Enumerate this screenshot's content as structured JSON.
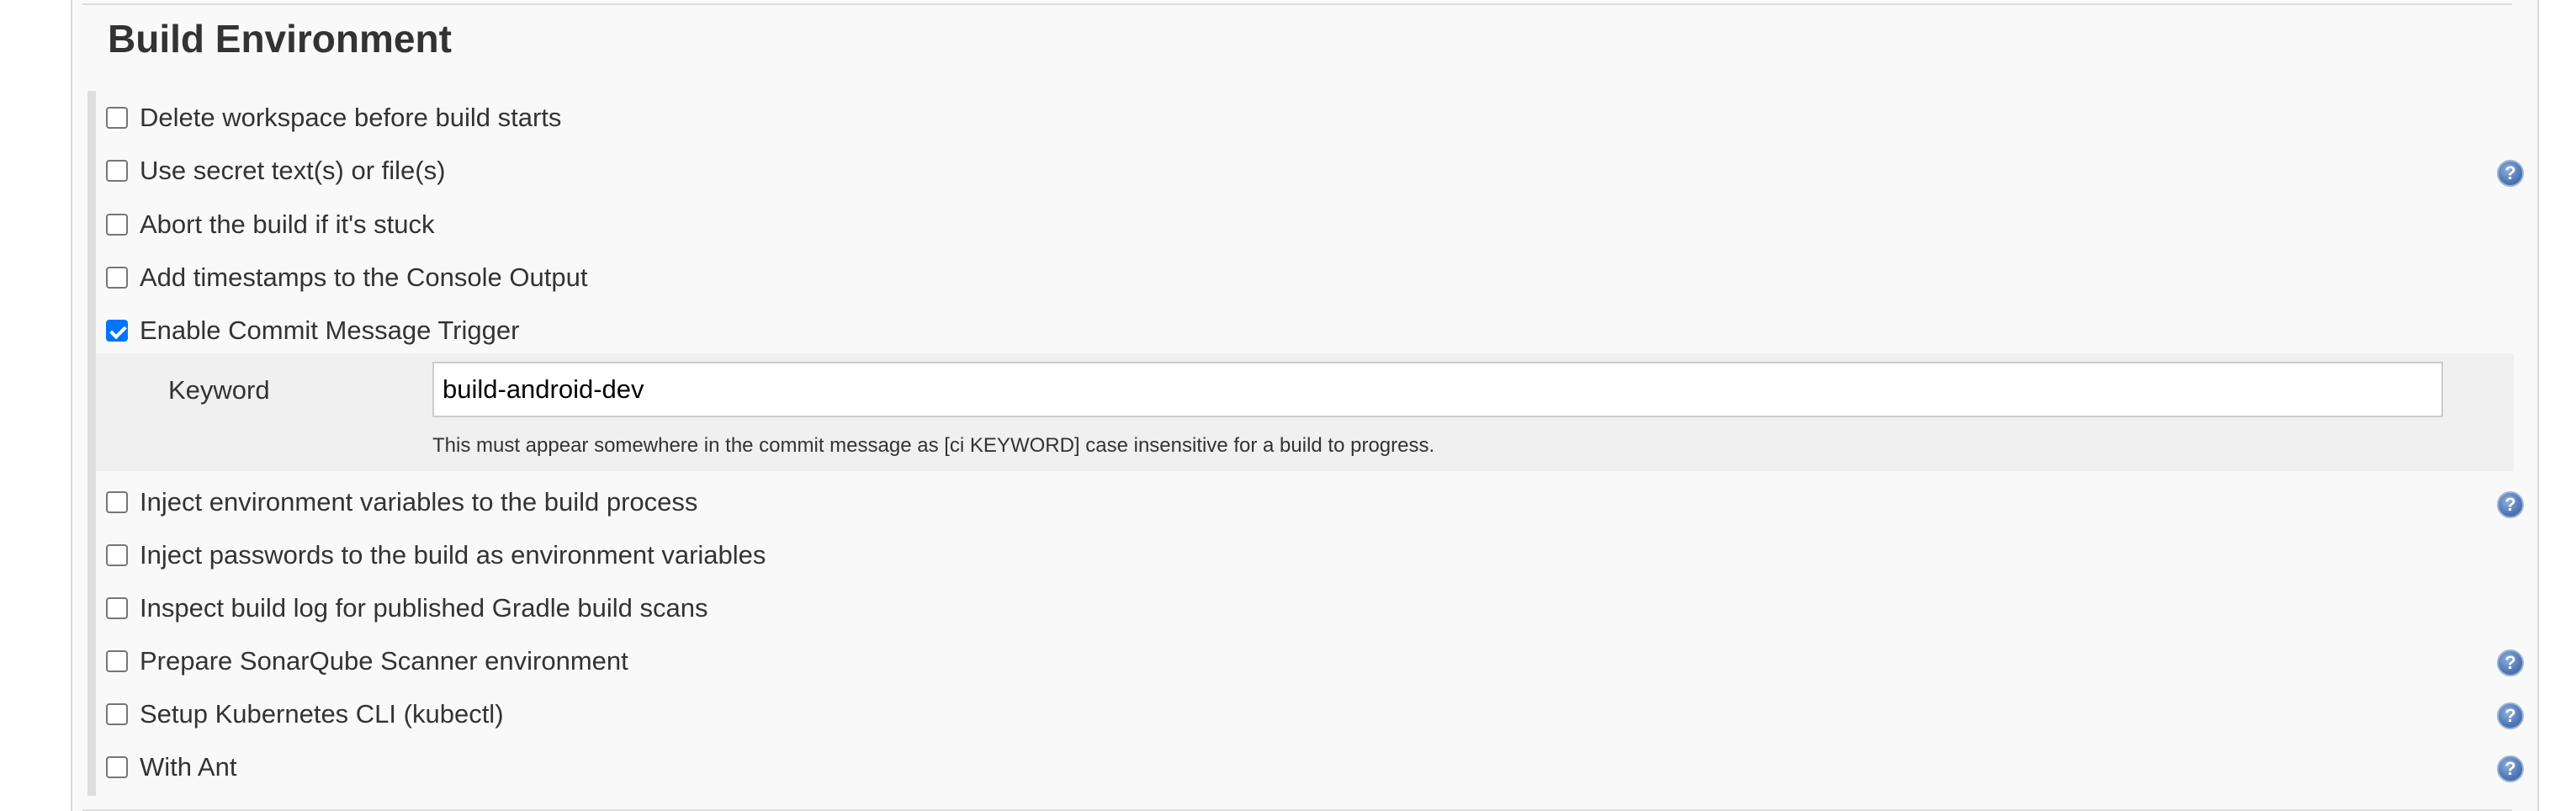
{
  "section": {
    "title": "Build Environment"
  },
  "options": [
    {
      "label": "Delete workspace before build starts",
      "checked": false,
      "help": false
    },
    {
      "label": "Use secret text(s) or file(s)",
      "checked": false,
      "help": true
    },
    {
      "label": "Abort the build if it's stuck",
      "checked": false,
      "help": false
    },
    {
      "label": "Add timestamps to the Console Output",
      "checked": false,
      "help": false
    },
    {
      "label": "Enable Commit Message Trigger",
      "checked": true,
      "help": false
    },
    {
      "label": "Inject environment variables to the build process",
      "checked": false,
      "help": true
    },
    {
      "label": "Inject passwords to the build as environment variables",
      "checked": false,
      "help": false
    },
    {
      "label": "Inspect build log for published Gradle build scans",
      "checked": false,
      "help": false
    },
    {
      "label": "Prepare SonarQube Scanner environment",
      "checked": false,
      "help": true
    },
    {
      "label": "Setup Kubernetes CLI (kubectl)",
      "checked": false,
      "help": true
    },
    {
      "label": "With Ant",
      "checked": false,
      "help": true
    }
  ],
  "commit_trigger": {
    "keyword_label": "Keyword",
    "keyword_value": "build-android-dev",
    "hint": "This must appear somewhere in the commit message as [ci KEYWORD] case insensitive for a build to progress."
  },
  "help_icon_glyph": "?",
  "colors": {
    "checkbox_checked": "#0075ff",
    "help_icon": "#4f77b5",
    "panel_background": "#f9f9f9"
  }
}
